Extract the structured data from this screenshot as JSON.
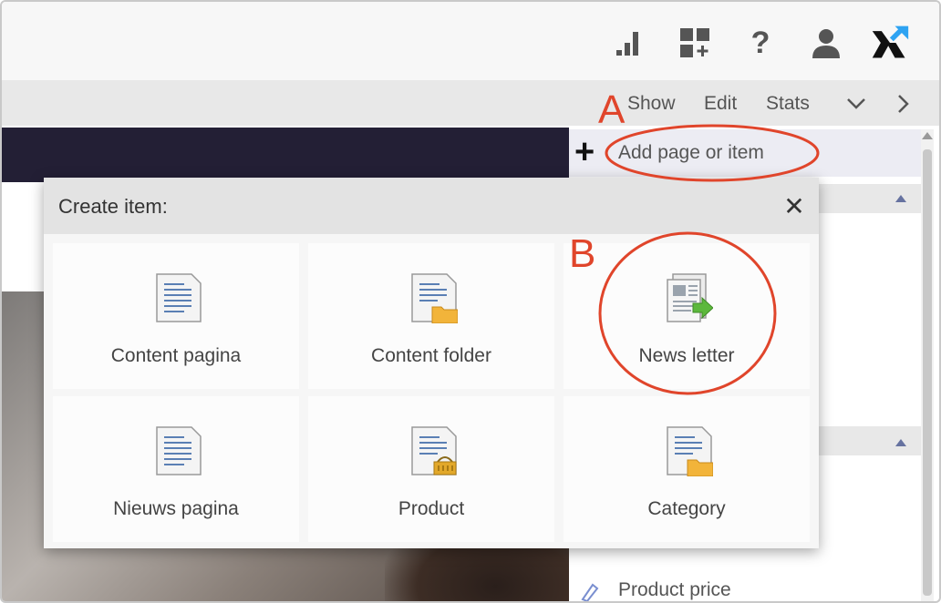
{
  "toolbar": {
    "icons": [
      "stats-icon",
      "add-widget-icon",
      "help-icon",
      "user-icon",
      "brand-logo-icon"
    ],
    "help_glyph": "?"
  },
  "subnav": {
    "show": "Show",
    "edit": "Edit",
    "stats": "Stats"
  },
  "sidebar": {
    "add_label": "Add page or item",
    "product_price": "Product price"
  },
  "annotations": {
    "a": "A",
    "b": "B"
  },
  "modal": {
    "title": "Create item:",
    "close": "✕",
    "items": [
      {
        "label": "Content pagina",
        "icon": "document-icon"
      },
      {
        "label": "Content folder",
        "icon": "document-folder-icon"
      },
      {
        "label": "News letter",
        "icon": "newsletter-icon"
      },
      {
        "label": "Nieuws pagina",
        "icon": "document-icon"
      },
      {
        "label": "Product",
        "icon": "document-product-icon"
      },
      {
        "label": "Category",
        "icon": "document-folder-icon"
      }
    ]
  },
  "colors": {
    "accent_annotation": "#e0452b",
    "dark_header": "#231f35",
    "logo_blue": "#2ea3f2"
  }
}
